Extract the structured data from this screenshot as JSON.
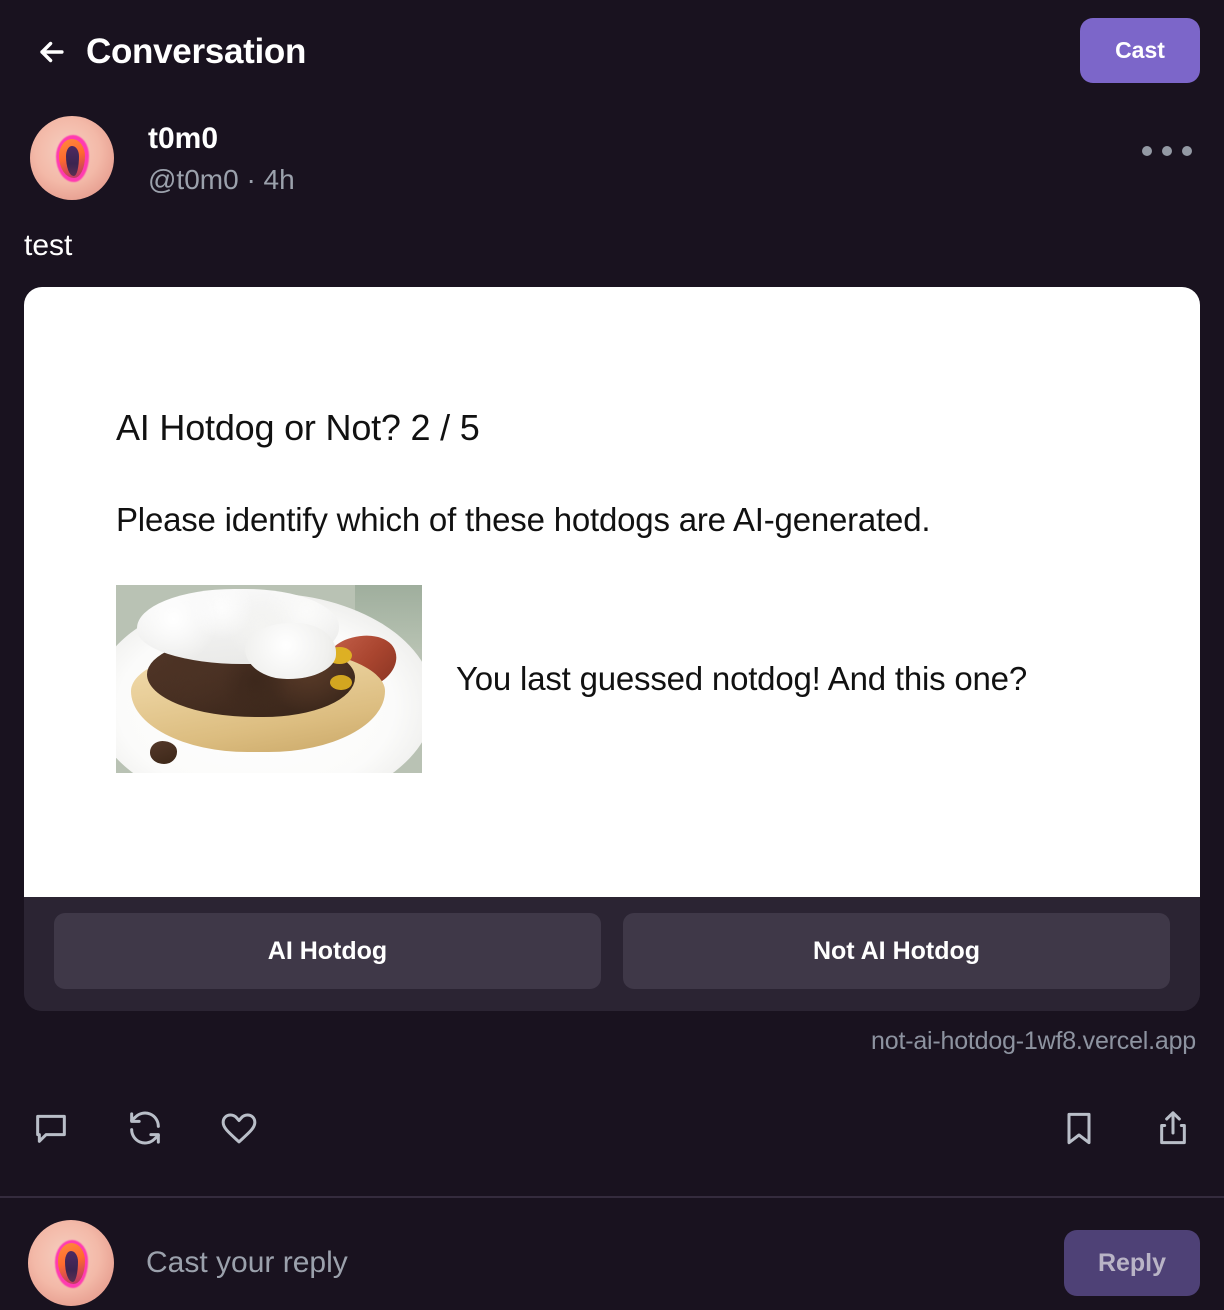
{
  "header": {
    "back_icon": "arrow-left-icon",
    "title": "Conversation",
    "cast_button": "Cast"
  },
  "cast": {
    "author": {
      "display_name": "t0m0",
      "handle": "@t0m0",
      "timestamp": "4h",
      "separator": "·",
      "meta_line": "@t0m0 · 4h",
      "avatar_icon": "avatar"
    },
    "more_icon": "ellipsis-icon",
    "text": "test",
    "frame": {
      "title": "AI Hotdog or Not? 2 / 5",
      "subtitle": "Please identify which of these hotdogs are AI-generated.",
      "image_alt": "hotdog-photo",
      "prompt": "You last guessed notdog! And this one?",
      "buttons": [
        {
          "label": "AI Hotdog"
        },
        {
          "label": "Not AI Hotdog"
        }
      ],
      "domain": "not-ai-hotdog-1wf8.vercel.app"
    },
    "actions": {
      "comment_icon": "comment-icon",
      "recast_icon": "recast-icon",
      "like_icon": "heart-icon",
      "bookmark_icon": "bookmark-icon",
      "share_icon": "share-icon"
    }
  },
  "reply": {
    "placeholder": "Cast your reply",
    "button_label": "Reply",
    "avatar_icon": "avatar"
  },
  "colors": {
    "background": "#19121f",
    "accent": "#7c66c9",
    "accent_muted": "#4e4176",
    "frame_surface": "#2b2433",
    "frame_button": "#3f3848",
    "muted_text": "#9ba1ac",
    "card_white": "#ffffff"
  }
}
